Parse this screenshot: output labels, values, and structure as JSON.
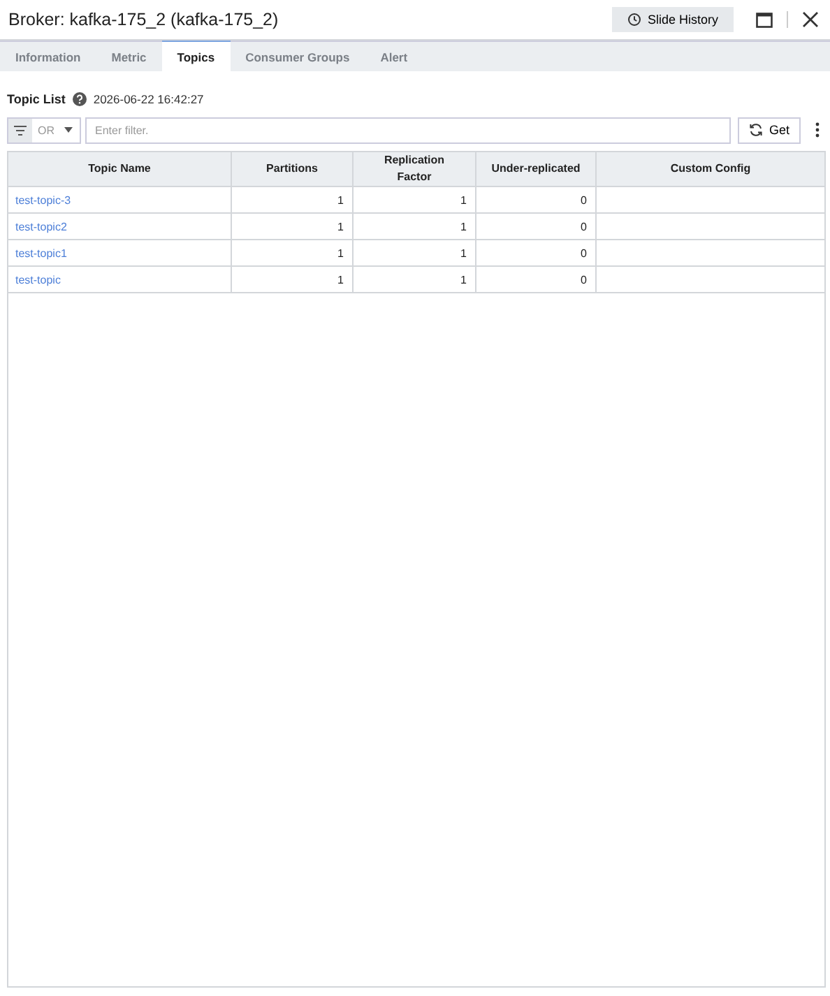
{
  "window": {
    "title": "Broker: kafka-175_2 (kafka-175_2)",
    "history_button": "Slide History"
  },
  "tabs": [
    {
      "label": "Information",
      "selected": false
    },
    {
      "label": "Metric",
      "selected": false
    },
    {
      "label": "Topics",
      "selected": true
    },
    {
      "label": "Consumer Groups",
      "selected": false
    },
    {
      "label": "Alert",
      "selected": false
    }
  ],
  "section": {
    "title": "Topic List",
    "timestamp": "2026-06-22 16:42:27"
  },
  "filter": {
    "operator": "OR",
    "placeholder": "Enter filter.",
    "get_button": "Get"
  },
  "table": {
    "columns": [
      "Topic Name",
      "Partitions",
      "Replication Factor",
      "Under-replicated",
      "Custom Config"
    ],
    "rows": [
      {
        "name": "test-topic-3",
        "partitions": "1",
        "replication": "1",
        "under_replicated": "0"
      },
      {
        "name": "test-topic2",
        "partitions": "1",
        "replication": "1",
        "under_replicated": "0"
      },
      {
        "name": "test-topic1",
        "partitions": "1",
        "replication": "1",
        "under_replicated": "0"
      },
      {
        "name": "test-topic",
        "partitions": "1",
        "replication": "1",
        "under_replicated": "0"
      }
    ]
  }
}
